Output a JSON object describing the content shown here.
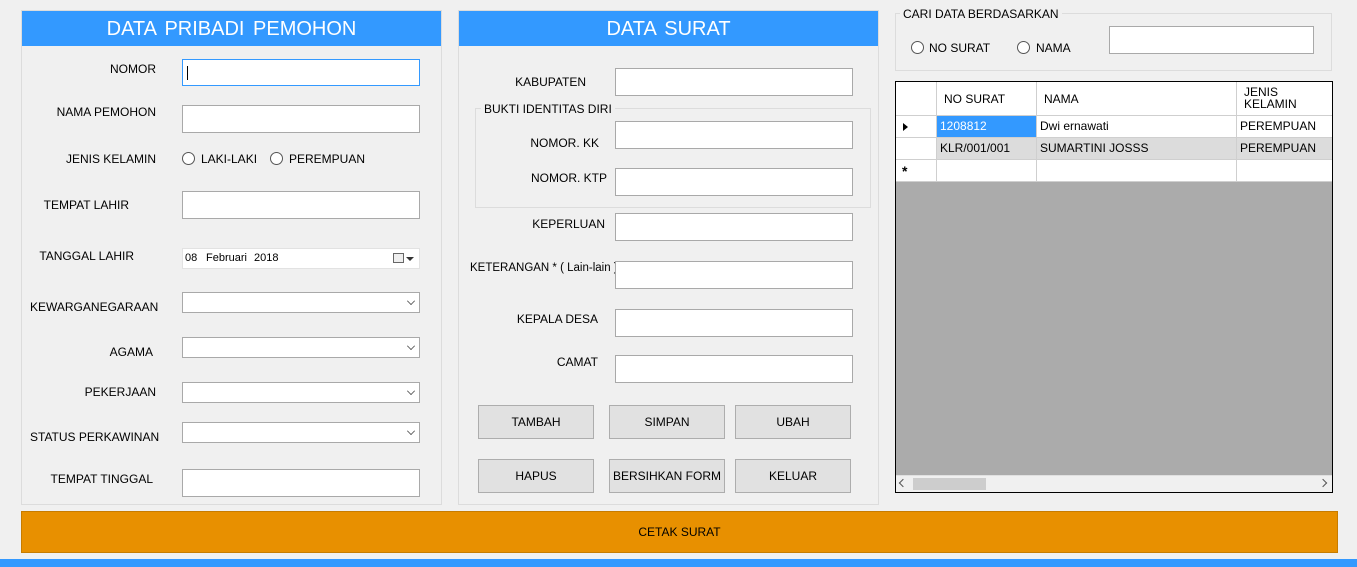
{
  "personal": {
    "title": "DATA  PRIBADI PEMOHON",
    "nomor_label": "NOMOR",
    "nomor_value": "",
    "nama_label": "NAMA PEMOHON",
    "nama_value": "",
    "gender_label": "JENIS KELAMIN",
    "gender_male": "LAKI-LAKI",
    "gender_female": "PEREMPUAN",
    "tempat_lahir_label": "TEMPAT LAHIR",
    "tempat_lahir_value": "",
    "tanggal_lahir_label": "TANGGAL LAHIR",
    "tanggal_lahir_day": "08",
    "tanggal_lahir_month": "Februari",
    "tanggal_lahir_year": "2018",
    "kewarganegaraan_label": "KEWARGANEGARAAN",
    "agama_label": "AGAMA",
    "pekerjaan_label": "PEKERJAAN",
    "status_label": "STATUS PERKAWINAN",
    "tempat_tinggal_label": "TEMPAT TINGGAL",
    "tempat_tinggal_value": ""
  },
  "surat": {
    "title": "DATA  SURAT",
    "kabupaten_label": "KABUPATEN",
    "bukti_group_label": "BUKTI IDENTITAS DIRI",
    "nomor_kk_label": "NOMOR. KK",
    "nomor_ktp_label": "NOMOR. KTP",
    "keperluan_label": "KEPERLUAN",
    "keterangan_label": "KETERANGAN * ( Lain-lain )",
    "kepala_desa_label": "KEPALA DESA",
    "camat_label": "CAMAT",
    "buttons": {
      "tambah": "TAMBAH",
      "simpan": "SIMPAN",
      "ubah": "UBAH",
      "hapus": "HAPUS",
      "bersihkan": "BERSIHKAN FORM",
      "keluar": "KELUAR"
    }
  },
  "search": {
    "group_label": "CARI DATA BERDASARKAN",
    "option_no_surat": "NO SURAT",
    "option_nama": "NAMA",
    "query": ""
  },
  "grid": {
    "columns": [
      "NO SURAT",
      "NAMA",
      "JENIS KELAMIN"
    ],
    "rows": [
      [
        "1208812",
        "Dwi ernawati",
        "PEREMPUAN"
      ],
      [
        "KLR/001/001",
        "SUMARTINI JOSSS",
        "PEREMPUAN"
      ]
    ],
    "new_row_marker": "*",
    "current_row_marker": "▶"
  },
  "cetak_label": "CETAK SURAT",
  "colors": {
    "header_blue": "#3399ff",
    "print_orange": "#e89000",
    "selected_cell": "#3399ff"
  }
}
